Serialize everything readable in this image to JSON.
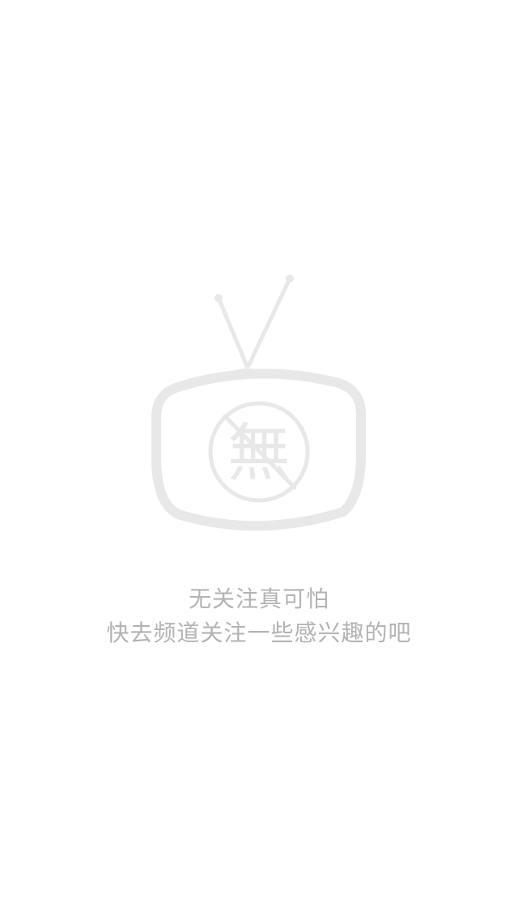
{
  "empty_state": {
    "illustration": {
      "icon": "tv-empty-icon",
      "glyph": "無",
      "color": "#e8e8e8"
    },
    "title": "无关注真可怕",
    "subtitle": "快去频道关注一些感兴趣的吧",
    "text_color": "#b3b3b3"
  }
}
